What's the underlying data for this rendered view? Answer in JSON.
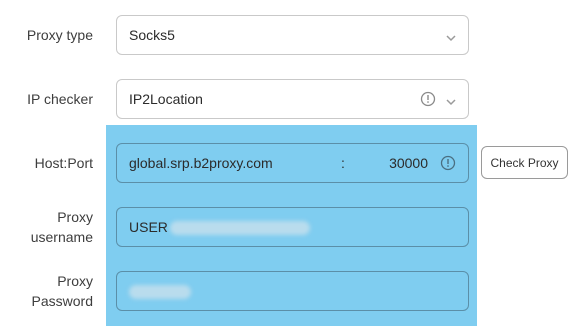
{
  "proxy_type": {
    "label": "Proxy type",
    "value": "Socks5"
  },
  "ip_checker": {
    "label": "IP checker",
    "value": "IP2Location"
  },
  "host_port": {
    "label": "Host:Port",
    "host": "global.srp.b2proxy.com",
    "separator": ":",
    "port": "30000",
    "check_button": "Check Proxy"
  },
  "proxy_username": {
    "label_line1": "Proxy",
    "label_line2": "username",
    "value_visible": "USER"
  },
  "proxy_password": {
    "label_line1": "Proxy",
    "label_line2": "Password"
  },
  "colors": {
    "highlight": "#7fcdf0"
  }
}
